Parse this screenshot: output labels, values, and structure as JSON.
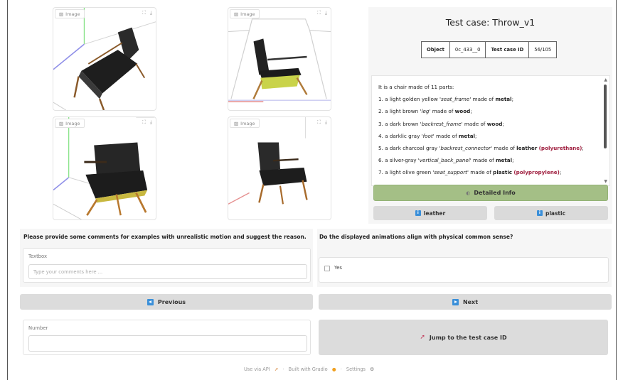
{
  "images": [
    {
      "label": "Image"
    },
    {
      "label": "Image"
    },
    {
      "label": "Image"
    },
    {
      "label": "Image"
    }
  ],
  "test_case": {
    "title": "Test case: Throw_v1",
    "object_header": "Object",
    "object_value": "0c_433__0",
    "id_header": "Test case ID",
    "id_value": "56/105"
  },
  "description": {
    "intro": "It is a chair made of 11 parts:",
    "parts": [
      {
        "prefix": "1. a light golden yellow '",
        "name": "seat_frame",
        "mid": "' made of ",
        "material": "metal",
        "extra": "",
        "suffix": ";"
      },
      {
        "prefix": "2. a light brown '",
        "name": "leg",
        "mid": "' made of ",
        "material": "wood",
        "extra": "",
        "suffix": ";"
      },
      {
        "prefix": "3. a dark brown '",
        "name": "backrest_frame",
        "mid": "' made of ",
        "material": "wood",
        "extra": "",
        "suffix": ";"
      },
      {
        "prefix": "4. a darklic gray '",
        "name": "foot",
        "mid": "' made of ",
        "material": "metal",
        "extra": "",
        "suffix": ";"
      },
      {
        "prefix": "5. a dark charcoal gray '",
        "name": "backrest_connector",
        "mid": "' made of ",
        "material": "leather",
        "extra": "(polyurethane)",
        "suffix": ";"
      },
      {
        "prefix": "6. a silver-gray '",
        "name": "vertical_back_panel",
        "mid": "' made of ",
        "material": "metal",
        "extra": "",
        "suffix": ";"
      },
      {
        "prefix": "7. a light olive green '",
        "name": "seat_support",
        "mid": "' made of ",
        "material": "plastic",
        "extra": "(polypropylene)",
        "suffix": ";"
      }
    ]
  },
  "buttons": {
    "detailed_info": "Detailed Info",
    "tag1": "leather",
    "tag2": "plastic",
    "previous": "Previous",
    "next": "Next",
    "jump": "Jump to the test case ID"
  },
  "comments": {
    "question": "Please provide some comments for examples with unrealistic motion and suggest the reason.",
    "label": "Textbox",
    "placeholder": "Type your comments here ..."
  },
  "common_sense": {
    "question": "Do the displayed animations align with physical common sense?",
    "option": "Yes"
  },
  "number": {
    "label": "Number",
    "value": ""
  },
  "footer": {
    "api": "Use via API",
    "gradio": "Built with Gradio",
    "settings": "Settings",
    "sep": "·"
  }
}
